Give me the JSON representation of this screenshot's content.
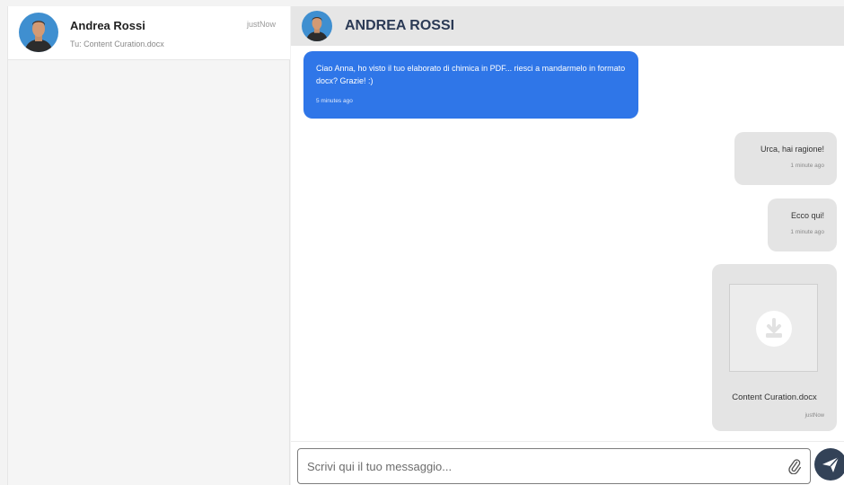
{
  "conversation_list": [
    {
      "name": "Andrea Rossi",
      "preview": "Tu: Content Curation.docx",
      "time": "justNow"
    }
  ],
  "chat": {
    "title": "ANDREA ROSSI",
    "messages": [
      {
        "direction": "in",
        "text": "Ciao Anna, ho visto il tuo elaborato di chimica in PDF... riesci a mandarmelo in formato docx? Grazie! :)",
        "time": "5 minutes ago"
      },
      {
        "direction": "out",
        "text": "Urca, hai ragione!",
        "time": "1 minute ago"
      },
      {
        "direction": "out",
        "text": "Ecco qui!",
        "time": "1 minute ago"
      }
    ],
    "attachment": {
      "file_name": "Content Curation.docx",
      "time": "justNow",
      "icon": "download-icon"
    }
  },
  "composer": {
    "placeholder": "Scrivi qui il tuo messaggio...",
    "attach_icon": "paperclip-icon",
    "send_icon": "paper-plane-icon"
  },
  "colors": {
    "incoming_bubble": "#2f76e8",
    "outgoing_bubble": "#e4e4e4",
    "header_bg": "#e6e6e6",
    "send_button": "#334257",
    "title_text": "#2b3a55"
  }
}
